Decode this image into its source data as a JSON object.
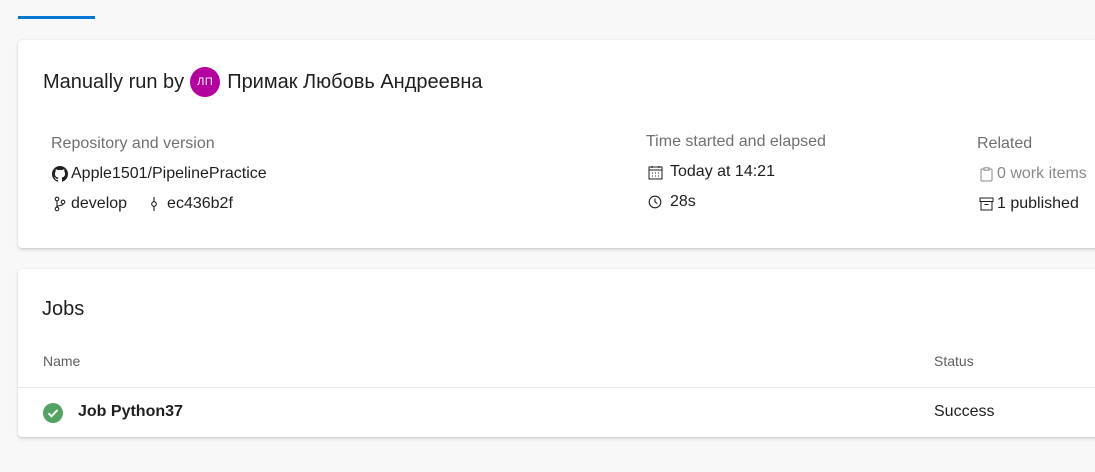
{
  "run": {
    "prefix": "Manually run by",
    "user_initials": "ЛП",
    "user_name": "Примак Любовь Андреевна"
  },
  "repo": {
    "label": "Repository and version",
    "name": "Apple1501/PipelinePractice",
    "branch": "develop",
    "commit": "ec436b2f"
  },
  "time": {
    "label": "Time started and elapsed",
    "started": "Today at 14:21",
    "elapsed": "28s"
  },
  "related": {
    "label": "Related",
    "work_items": "0 work items",
    "published": "1 published"
  },
  "jobs": {
    "title": "Jobs",
    "col_name": "Name",
    "col_status": "Status",
    "rows": [
      {
        "name": "Job Python37",
        "status": "Success"
      }
    ]
  },
  "colors": {
    "accent": "#0078d4",
    "avatar": "#b4009e",
    "success": "#55a362"
  }
}
